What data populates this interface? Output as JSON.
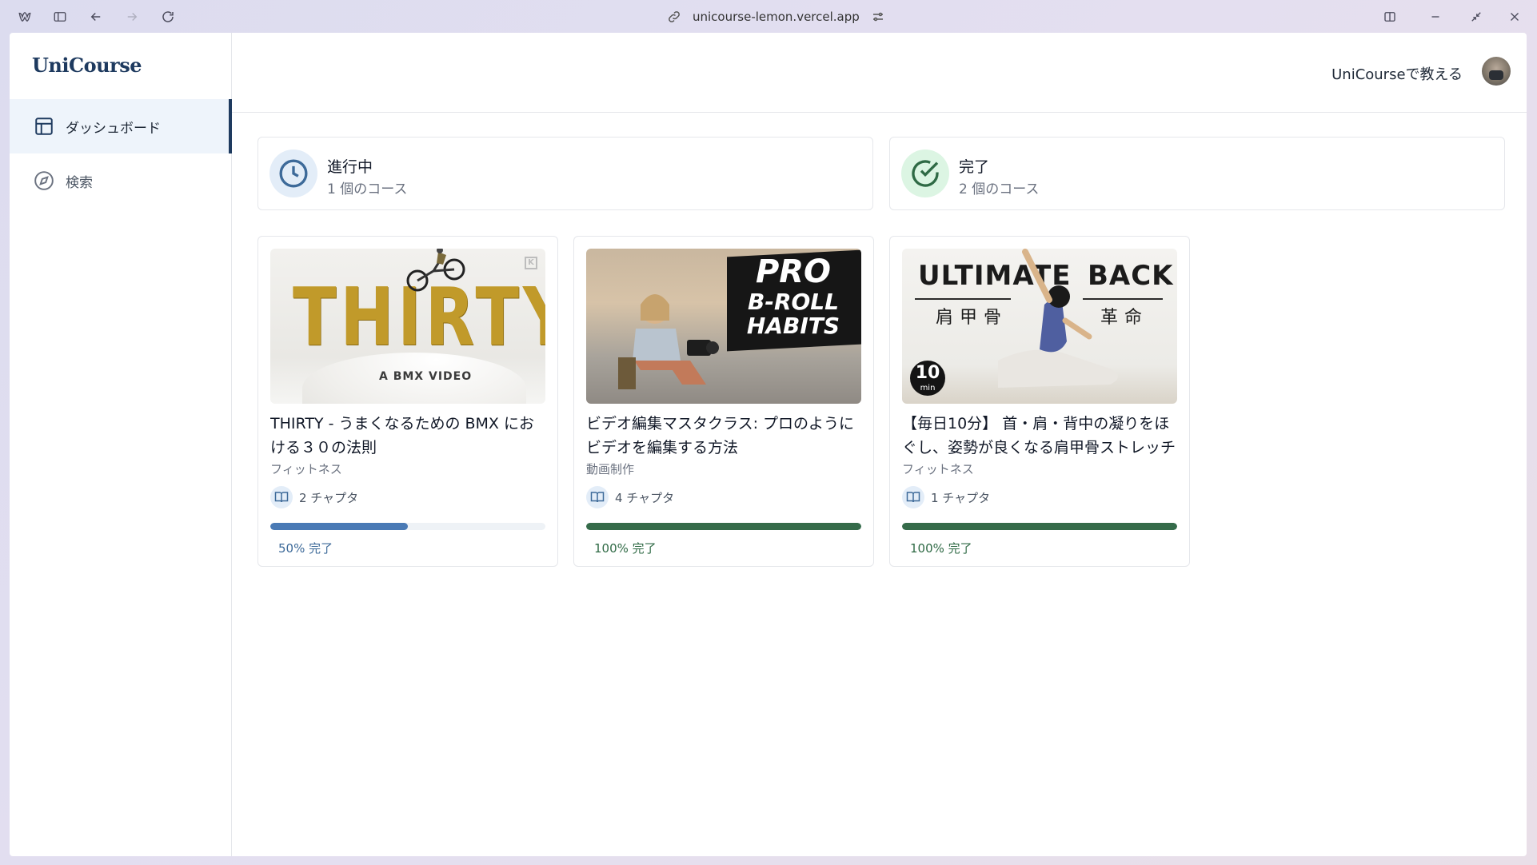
{
  "browser": {
    "url": "unicourse-lemon.vercel.app"
  },
  "app": {
    "logo": "UniCourse",
    "teach_link": "UniCourseで教える"
  },
  "sidebar": {
    "items": [
      {
        "label": "ダッシュボード",
        "icon": "layout-icon",
        "active": true
      },
      {
        "label": "検索",
        "icon": "compass-icon",
        "active": false
      }
    ]
  },
  "stats": {
    "in_progress": {
      "title": "進行中",
      "subtitle": "1 個のコース",
      "icon": "clock-icon"
    },
    "completed": {
      "title": "完了",
      "subtitle": "2 個のコース",
      "icon": "check-circle-icon"
    }
  },
  "courses": [
    {
      "thumbnail": {
        "title": "THIRTY",
        "subtitle": "A BMX VIDEO",
        "badge": "K"
      },
      "title": "THIRTY - うまくなるための BMX における３０の法則",
      "category": "フィットネス",
      "chapters": "2 チャプタ",
      "progress": 0.5,
      "progress_label": "50% 完了",
      "color": "#4a7ab5"
    },
    {
      "thumbnail": {
        "line1": "PRO",
        "line2": "B-ROLL",
        "line3": "HABITS"
      },
      "title": "ビデオ編集マスタクラス: プロのようにビデオを編集する方法",
      "category": "動画制作",
      "chapters": "4 チャプタ",
      "progress": 1.0,
      "progress_label": "100% 完了",
      "color": "#356b4a"
    },
    {
      "thumbnail": {
        "word1": "ULTIMATE",
        "word2": "BACK",
        "kanji1": "肩甲骨",
        "kanji2": "革命",
        "badge_num": "10",
        "badge_unit": "min"
      },
      "title": "【毎日10分】 首・肩・背中の凝りをほぐし、姿勢が良くなる肩甲骨ストレッチ",
      "category": "フィットネス",
      "chapters": "1 チャプタ",
      "progress": 1.0,
      "progress_label": "100% 完了",
      "color": "#356b4a"
    }
  ]
}
